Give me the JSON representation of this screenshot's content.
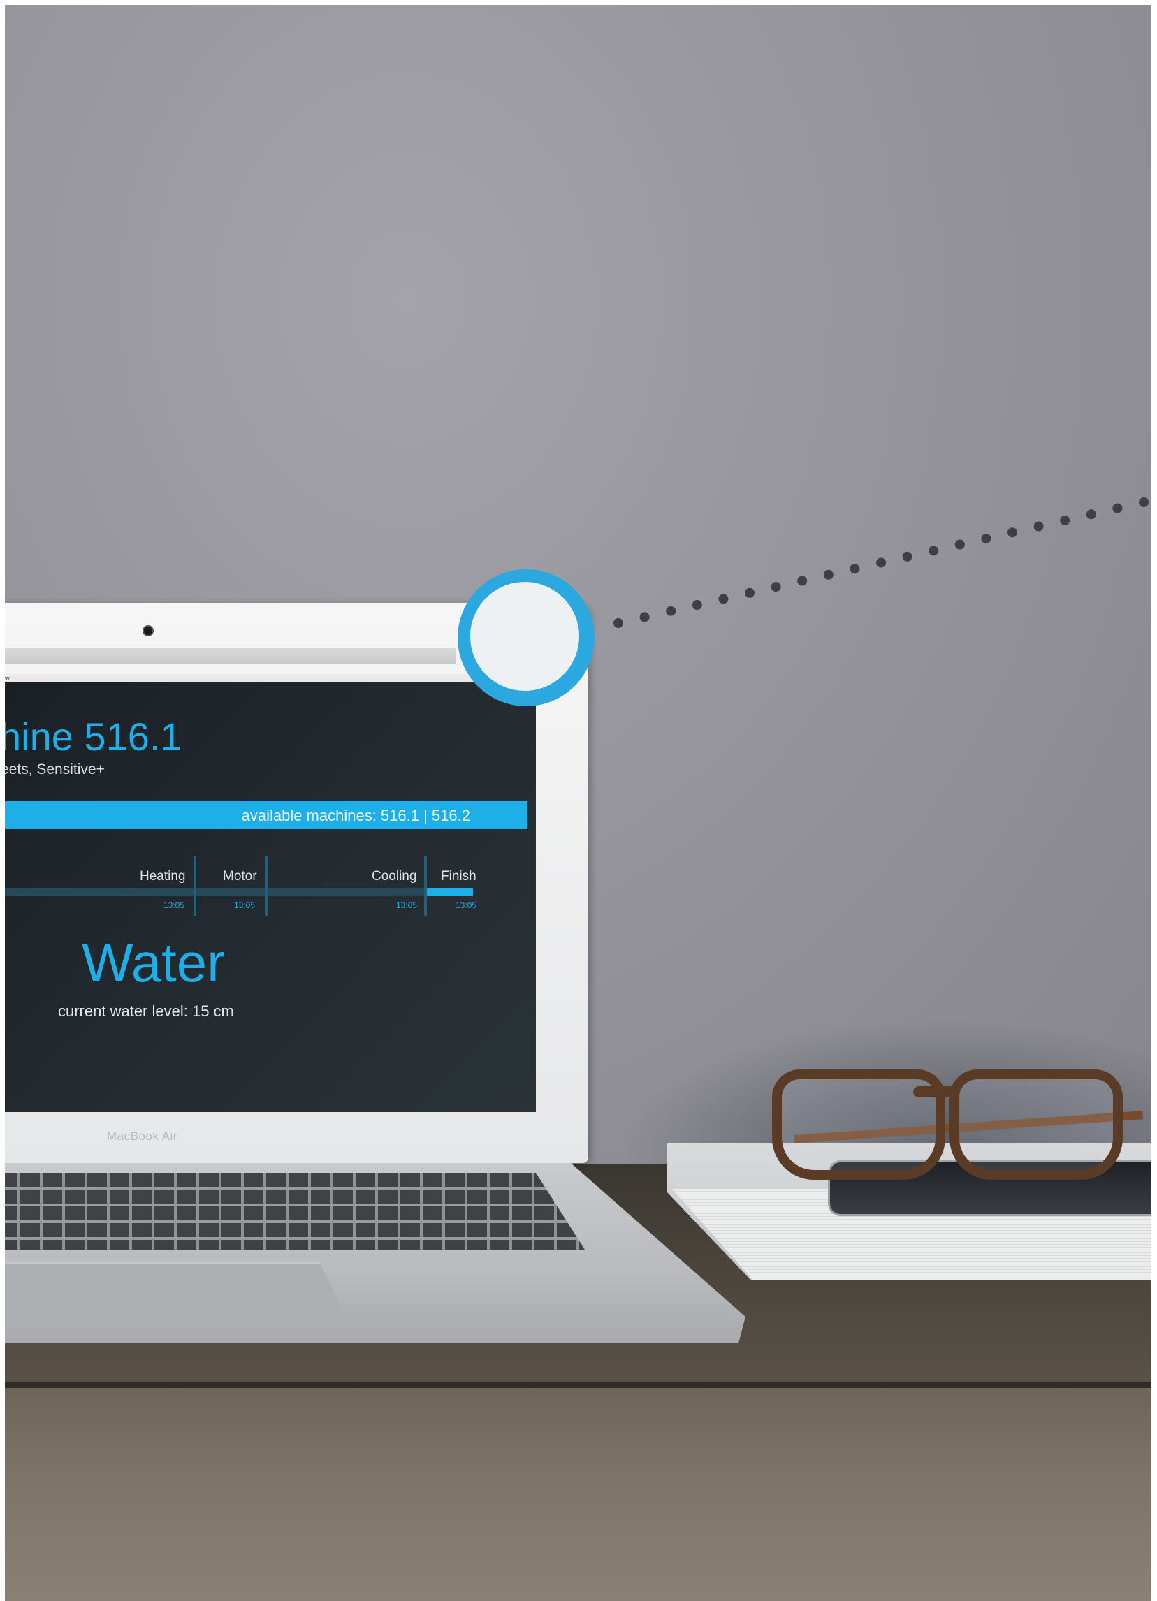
{
  "app": {
    "title": "hine 516.1",
    "subtitle": "eets, Sensitive+",
    "available_machines": "available machines: 516.1 | 516.2"
  },
  "progress": {
    "steps": [
      {
        "label": "Heating",
        "time": "13:05"
      },
      {
        "label": "Motor",
        "time": "13:05"
      },
      {
        "label": "Cooling",
        "time": "13:05"
      },
      {
        "label": "Finish",
        "time": "13:05"
      }
    ],
    "current_step": "Finish"
  },
  "status": {
    "title": "Water",
    "detail": "current water level: 15 cm"
  },
  "device": {
    "brand": "MacBook Air",
    "toolbar_char": "w"
  },
  "colors": {
    "accent": "#1eaee8",
    "screen_bg": "#1f262b",
    "marker": "#2aa8df"
  }
}
